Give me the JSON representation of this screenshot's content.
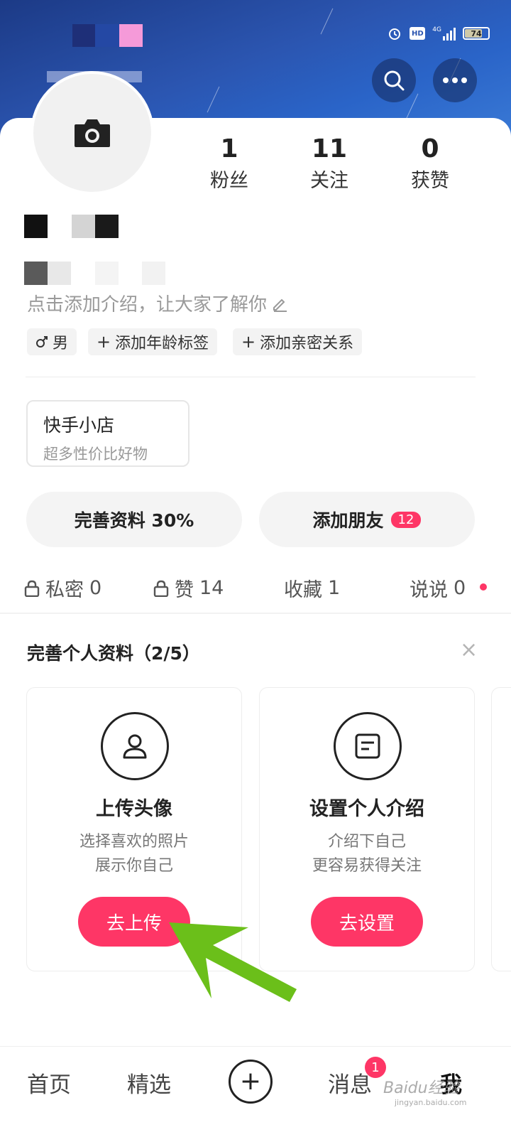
{
  "status_bar": {
    "battery": "74",
    "hd_label": "HD",
    "network": "4G"
  },
  "profile": {
    "stats": [
      {
        "value": "1",
        "label": "粉丝"
      },
      {
        "value": "11",
        "label": "关注"
      },
      {
        "value": "0",
        "label": "获赞"
      }
    ],
    "intro_placeholder": "点击添加介绍，让大家了解你",
    "tags": [
      {
        "icon": "male-icon",
        "label": "男"
      },
      {
        "icon": "plus-icon",
        "label": "添加年龄标签"
      },
      {
        "icon": "plus-icon",
        "label": "添加亲密关系"
      }
    ]
  },
  "shop": {
    "title": "快手小店",
    "subtitle": "超多性价比好物"
  },
  "actions": {
    "complete_profile_label": "完善资料 30%",
    "add_friends_label": "添加朋友",
    "add_friends_badge": "12"
  },
  "tabs": [
    {
      "label": "私密",
      "count": "0",
      "icon": "lock-icon"
    },
    {
      "label": "赞",
      "count": "14",
      "icon": "lock-icon"
    },
    {
      "label": "收藏",
      "count": "1"
    },
    {
      "label": "说说",
      "count": "0"
    }
  ],
  "tasks_section": {
    "title": "完善个人资料（2/5）",
    "close": "×",
    "cards": [
      {
        "icon": "person-icon",
        "title": "上传头像",
        "desc1": "选择喜欢的照片",
        "desc2": "展示你自己",
        "button": "去上传"
      },
      {
        "icon": "note-icon",
        "title": "设置个人介绍",
        "desc1": "介绍下自己",
        "desc2": "更容易获得关注",
        "button": "去设置"
      }
    ]
  },
  "bottom_nav": {
    "home": "首页",
    "featured": "精选",
    "create": "+",
    "messages": "消息",
    "messages_badge": "1",
    "me": "我"
  },
  "watermark": {
    "brand": "Baidu经验",
    "url": "jingyan.baidu.com"
  },
  "colors": {
    "accent": "#fe3666",
    "banner": "#2b55b0",
    "arrow": "#6bbf1a"
  }
}
